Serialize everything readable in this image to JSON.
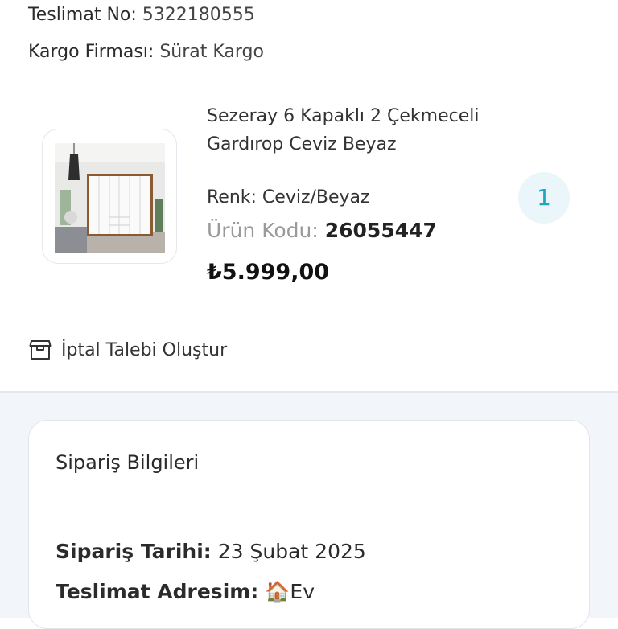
{
  "delivery": {
    "number_label": "Teslimat No:",
    "number_value": "5322180555",
    "carrier_label": "Kargo Firması:",
    "carrier_value": "Sürat Kargo"
  },
  "product": {
    "name": "Sezeray 6 Kapaklı 2 Çekmeceli Gardırop Ceviz Beyaz",
    "color_text": "Renk: Ceviz/Beyaz",
    "code_label": "Ürün Kodu:",
    "code_value": "26055447",
    "price": "₺5.999,00",
    "quantity": "1",
    "image_icon": "wardrobe-product-image"
  },
  "actions": {
    "cancel_label": "İptal Talebi Oluştur",
    "cancel_icon": "box-icon"
  },
  "order_info": {
    "title": "Sipariş Bilgileri",
    "date_label": "Sipariş Tarihi:",
    "date_value": "23 Şubat 2025",
    "address_label": "Teslimat Adresim:",
    "address_emoji": "🏠",
    "address_value": "Ev"
  },
  "colors": {
    "accent": "#1fa6c2",
    "accent_bg": "#eaf6fa",
    "page_bg": "#f2f5f9"
  }
}
